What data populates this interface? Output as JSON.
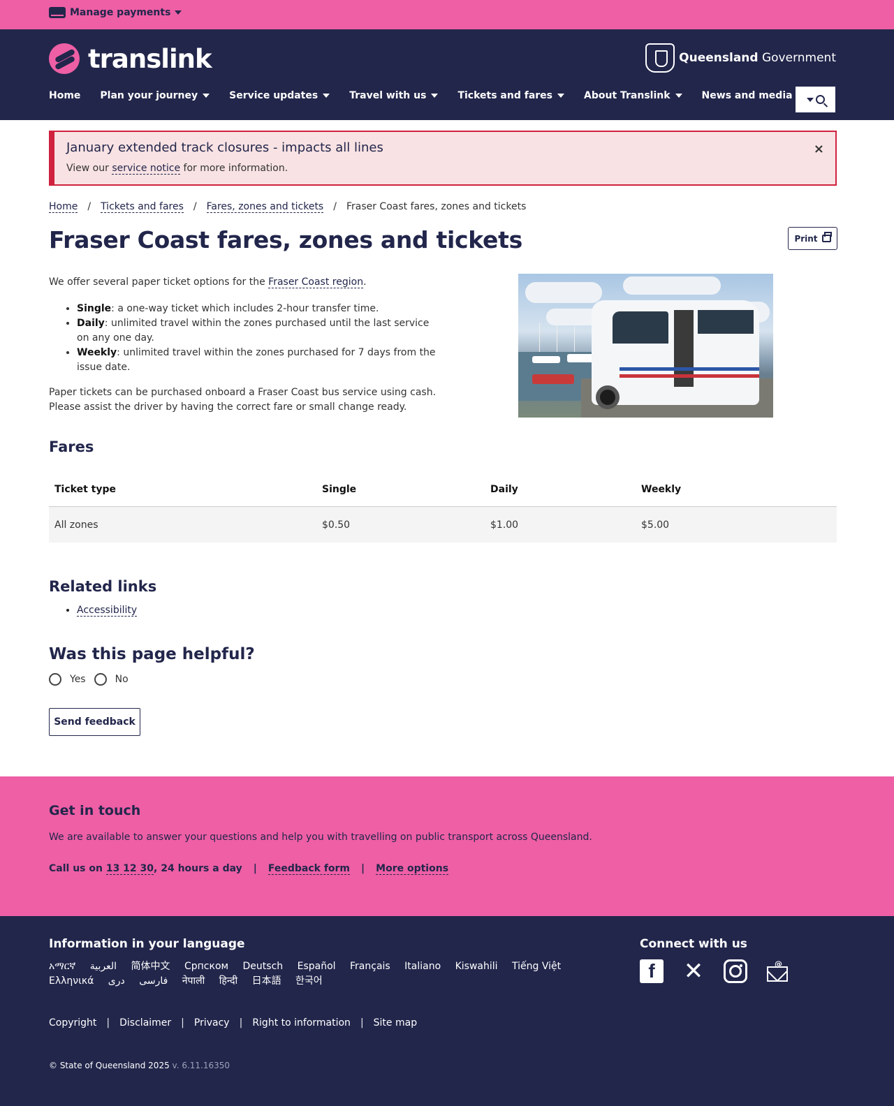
{
  "topbar": {
    "manage_label": "Manage payments"
  },
  "header": {
    "logo_text": "translink",
    "gov_bold": "Queensland",
    "gov_rest": " Government",
    "nav": [
      "Home",
      "Plan your journey",
      "Service updates",
      "Travel with us",
      "Tickets and fares",
      "About Translink",
      "News and media"
    ]
  },
  "alert": {
    "title": "January extended track closures - impacts all lines",
    "text_before": "View our ",
    "link": "service notice",
    "text_after": " for more information.",
    "close": "×"
  },
  "breadcrumb": {
    "items": [
      "Home",
      "Tickets and fares",
      "Fares, zones and tickets"
    ],
    "current": "Fraser Coast fares, zones and tickets",
    "separator": "/"
  },
  "page": {
    "title": "Fraser Coast fares, zones and tickets",
    "print_label": "Print",
    "intro_before": "We offer several paper ticket options for the ",
    "intro_link": "Fraser Coast region",
    "intro_after": ".",
    "bullets": [
      {
        "term": "Single",
        "text": ": a one-way ticket which includes 2-hour transfer time."
      },
      {
        "term": "Daily",
        "text": ": unlimited travel within the zones purchased until the last service on any one day."
      },
      {
        "term": "Weekly",
        "text": ": unlimited travel within the zones purchased for 7 days from the issue date."
      }
    ],
    "paper_text": "Paper tickets can be purchased onboard a Fraser Coast bus service using cash. Please assist the driver by having the correct fare or small change ready."
  },
  "fares": {
    "heading": "Fares",
    "headers": [
      "Ticket type",
      "Single",
      "Daily",
      "Weekly"
    ],
    "rows": [
      [
        "All zones",
        "$0.50",
        "$1.00",
        "$5.00"
      ]
    ]
  },
  "related": {
    "heading": "Related links",
    "links": [
      "Accessibility"
    ]
  },
  "feedback": {
    "heading": "Was this page helpful?",
    "yes": "Yes",
    "no": "No",
    "send": "Send feedback"
  },
  "touch": {
    "heading": "Get in touch",
    "text": "We are available to answer your questions and help you with travelling on public transport across Queensland.",
    "call_before": "Call us on ",
    "phone": "13 12 30",
    "call_after": ", 24 hours a day",
    "sep": "|",
    "feedback_form": "Feedback form",
    "more_options": "More options"
  },
  "footer": {
    "lang_heading": "Information in your language",
    "languages": [
      "አማርኛ",
      "العربية",
      "简体中文",
      "Српском",
      "Deutsch",
      "Español",
      "Français",
      "Italiano",
      "Kiswahili",
      "Tiếng Việt",
      "Ελληνικά",
      "دری",
      "فارسی",
      "नेपाली",
      "हिन्दी",
      "日本語",
      "한국어"
    ],
    "connect_heading": "Connect with us",
    "socials": [
      "facebook-icon",
      "x-icon",
      "instagram-icon",
      "email-icon"
    ],
    "legal": [
      "Copyright",
      "Disclaimer",
      "Privacy",
      "Right to information",
      "Site map"
    ],
    "legal_sep": "|",
    "copyright": "© State of Queensland 2025",
    "version": " v. 6.11.16350"
  },
  "colors": {
    "navy": "#22264b",
    "pink": "#ee5fa5",
    "alert_red": "#d0213e",
    "alert_bg": "#f8e2e3"
  }
}
